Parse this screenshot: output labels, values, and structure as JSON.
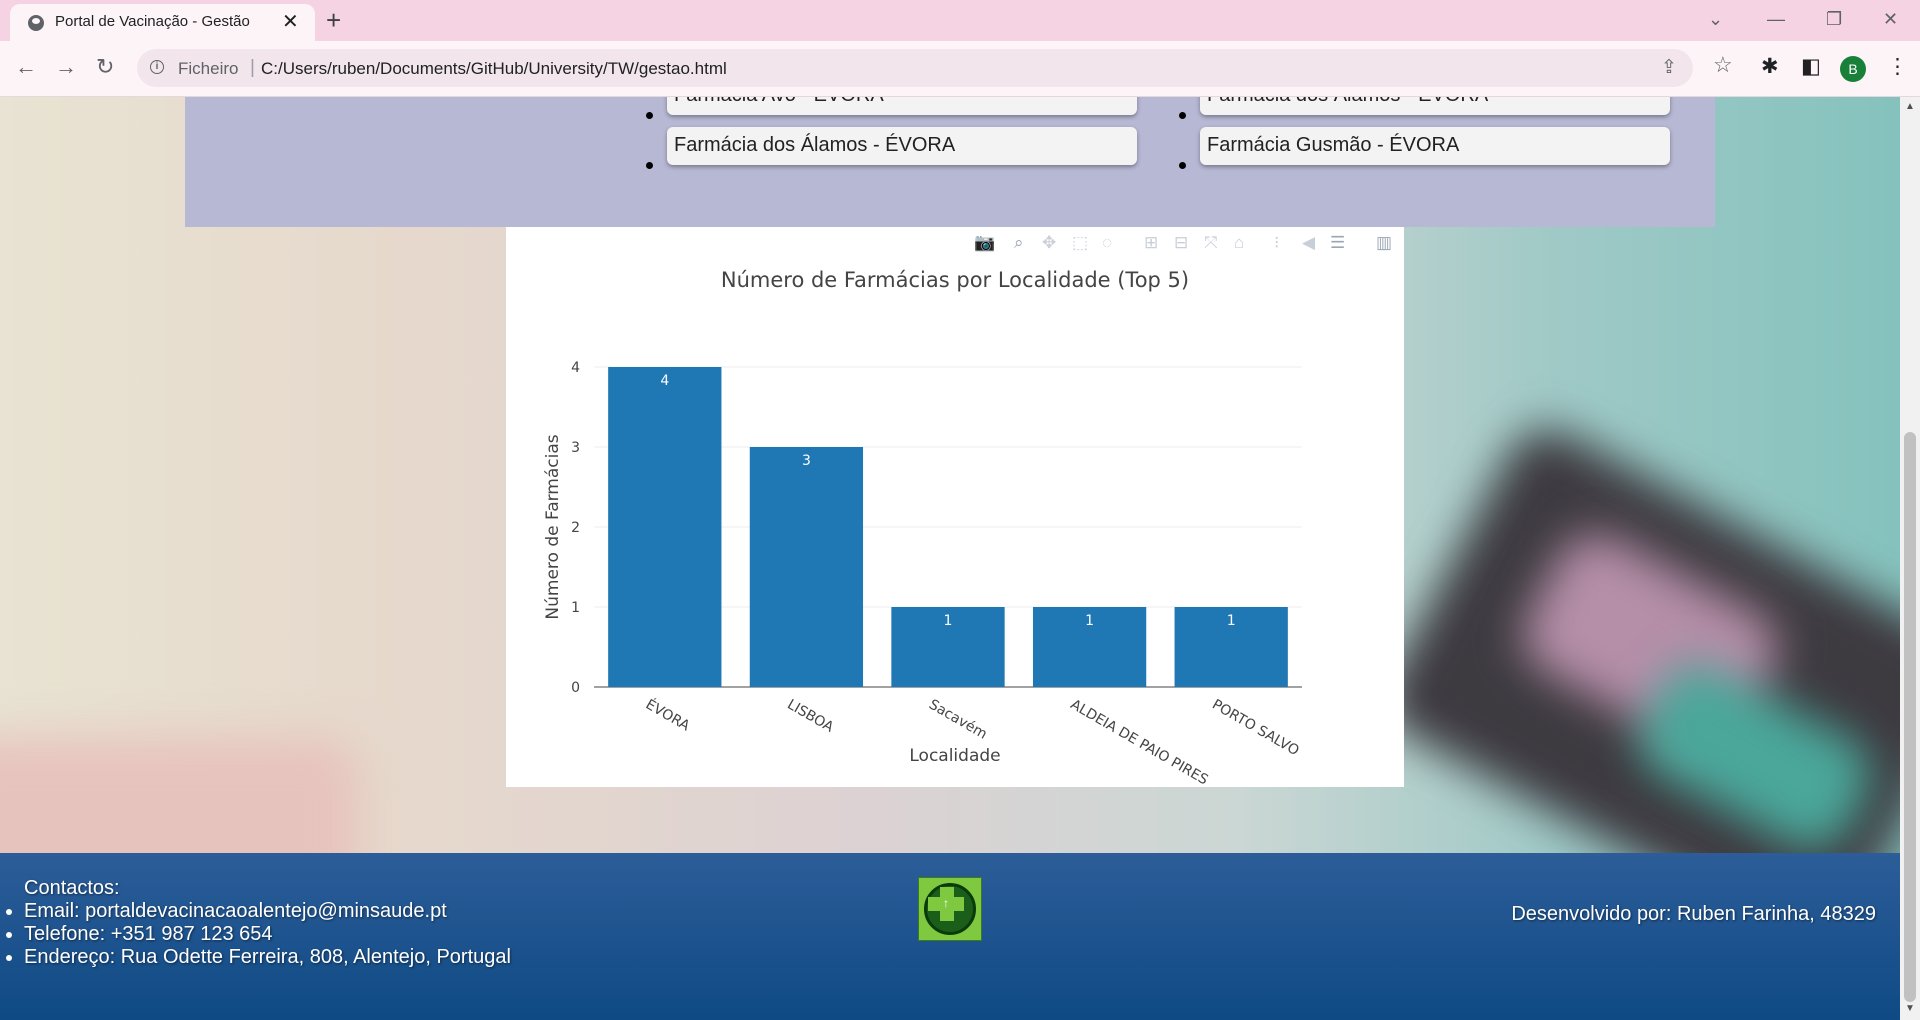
{
  "browser": {
    "tab_title": "Portal de Vacinação - Gestão",
    "url_scheme": "Ficheiro",
    "url": "C:/Users/ruben/Documents/GitHub/University/TW/gestao.html",
    "profile_initial": "B"
  },
  "pharmacies": {
    "left": [
      "Farmácia Avó - ÉVORA",
      "Farmácia dos Álamos - ÉVORA"
    ],
    "right": [
      "Farmácia dos Álamos - ÉVORA",
      "Farmácia Gusmão - ÉVORA"
    ]
  },
  "chart_data": {
    "type": "bar",
    "title": "Número de Farmácias por Localidade (Top 5)",
    "xlabel": "Localidade",
    "ylabel": "Número de Farmácias",
    "categories": [
      "ÉVORA",
      "LISBOA",
      "Sacavém",
      "ALDEIA DE PAIO PIRES",
      "PORTO SALVO"
    ],
    "values": [
      4,
      3,
      1,
      1,
      1
    ],
    "ylim": [
      0,
      4
    ],
    "yticks": [
      0,
      1,
      2,
      3,
      4
    ],
    "bar_color": "#1f77b4",
    "grid": true,
    "legend": "none"
  },
  "footer": {
    "contacts_title": "Contactos:",
    "email": "Email: portaldevacinacaoalentejo@minsaude.pt",
    "phone": "Telefone: +351 987 123 654",
    "address": "Endereço: Rua Odette Ferreira, 808, Alentejo, Portugal",
    "developer": "Desenvolvido por: Ruben Farinha, 48329"
  },
  "colors": {
    "list_section_bg": "#b7b8d4",
    "footer_bg": "#0f4a84",
    "tabstrip_bg": "#f6d3e2"
  }
}
